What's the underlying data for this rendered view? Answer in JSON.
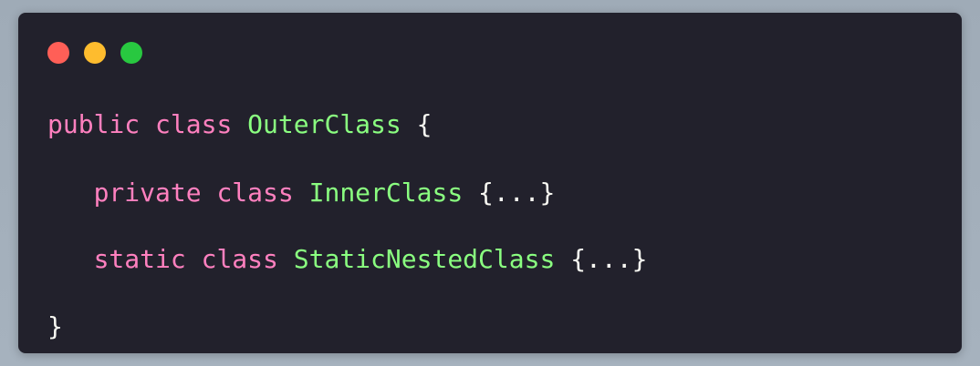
{
  "window": {
    "traffic_lights": [
      {
        "name": "close",
        "color": "#ff5f57"
      },
      {
        "name": "minimize",
        "color": "#febc2e"
      },
      {
        "name": "zoom",
        "color": "#28c840"
      }
    ]
  },
  "code": {
    "lines": [
      {
        "indent": "",
        "kw1": "public",
        "kw2": "class",
        "name": "OuterClass",
        "tail": "{"
      },
      {
        "indent": "   ",
        "kw1": "private",
        "kw2": "class",
        "name": "InnerClass",
        "tail": "{...}"
      },
      {
        "indent": "   ",
        "kw1": "static",
        "kw2": "class",
        "name": "StaticNestedClass",
        "tail": "{...}"
      },
      {
        "indent": "",
        "close": "}"
      }
    ]
  },
  "colors": {
    "background": "#22212c",
    "keyword": "#ff80bf",
    "class_name": "#8aff80",
    "text": "#f8f8f2"
  }
}
